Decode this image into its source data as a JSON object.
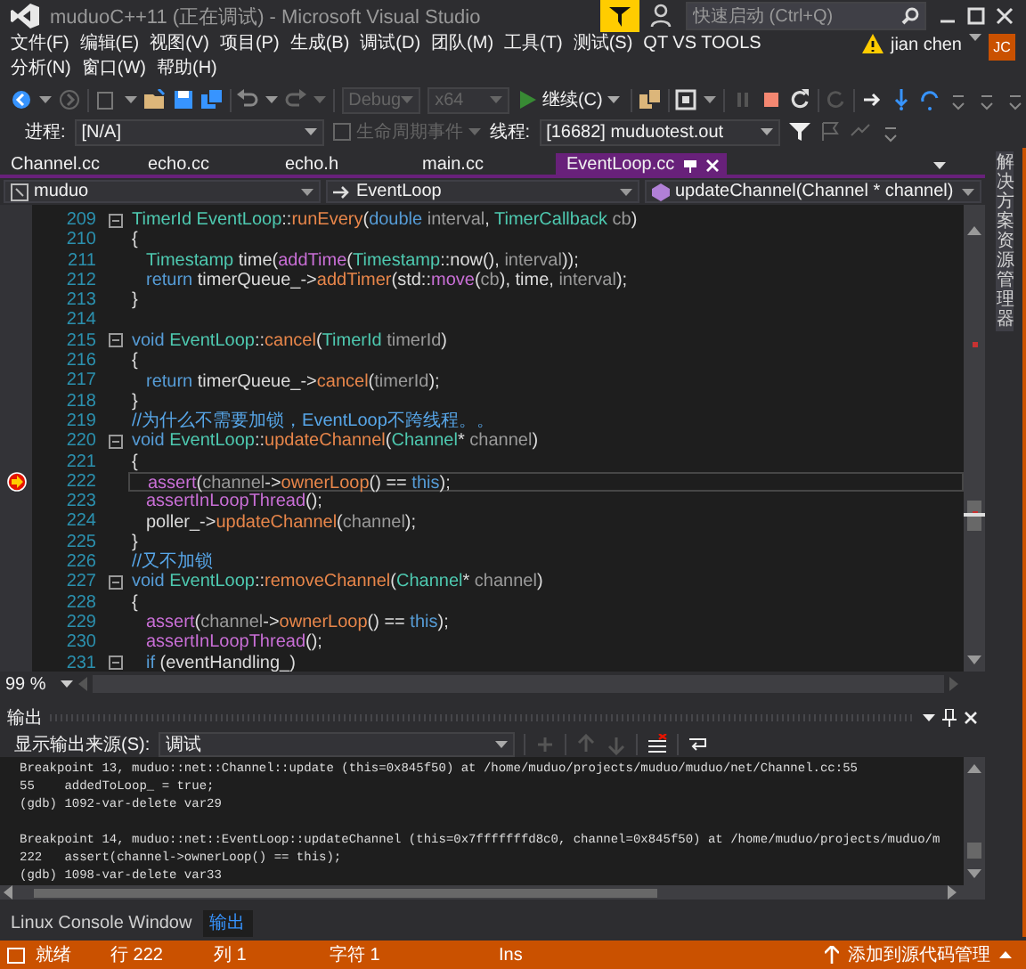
{
  "window": {
    "title": "muduoC++11 (正在调试) - Microsoft Visual Studio"
  },
  "quick_launch": {
    "placeholder": "快速启动 (Ctrl+Q)"
  },
  "account": {
    "name": "jian chen",
    "initials": "JC"
  },
  "menu": [
    "文件(F)",
    "编辑(E)",
    "视图(V)",
    "项目(P)",
    "生成(B)",
    "调试(D)",
    "团队(M)",
    "工具(T)",
    "测试(S)",
    "QT VS TOOLS",
    "分析(N)",
    "窗口(W)",
    "帮助(H)"
  ],
  "toolbar": {
    "configuration": "Debug",
    "platform": "x64",
    "continue": "继续(C)"
  },
  "debug_location": {
    "process_label": "进程:",
    "process": "[N/A]",
    "lifecycle": "生命周期事件",
    "thread_label": "线程:",
    "thread": "[16682] muduotest.out"
  },
  "tabs": [
    {
      "label": "Channel.cc",
      "selected": false
    },
    {
      "label": "echo.cc",
      "selected": false
    },
    {
      "label": "echo.h",
      "selected": false
    },
    {
      "label": "main.cc",
      "selected": false
    },
    {
      "label": "EventLoop.cc",
      "selected": true
    }
  ],
  "navigation": {
    "project": "muduo",
    "scope": "EventLoop",
    "member": "updateChannel(Channel * channel)"
  },
  "editor": {
    "lines": [
      {
        "number": "209",
        "fold": true,
        "body": false,
        "breakpoint": false,
        "tokens": [
          {
            "kind": "type",
            "text": "TimerId"
          },
          {
            "kind": "type",
            "text": " EventLoop"
          },
          {
            "kind": "plain",
            "text": "::"
          },
          {
            "kind": "function",
            "text": "runEvery"
          },
          {
            "kind": "plain",
            "text": "("
          },
          {
            "kind": "keyword",
            "text": "double"
          },
          {
            "kind": "param",
            "text": " interval"
          },
          {
            "kind": "plain",
            "text": ", "
          },
          {
            "kind": "type",
            "text": "TimerCallback"
          },
          {
            "kind": "param",
            "text": " cb"
          },
          {
            "kind": "plain",
            "text": ")"
          }
        ]
      },
      {
        "number": "210",
        "fold": false,
        "body": false,
        "breakpoint": false,
        "tokens": [
          {
            "kind": "plain",
            "text": "{"
          }
        ]
      },
      {
        "number": "211",
        "fold": false,
        "body": true,
        "breakpoint": false,
        "tokens": [
          {
            "kind": "type",
            "text": "Timestamp"
          },
          {
            "kind": "plain",
            "text": " time("
          },
          {
            "kind": "macro",
            "text": "addTime"
          },
          {
            "kind": "plain",
            "text": "("
          },
          {
            "kind": "type",
            "text": "Timestamp"
          },
          {
            "kind": "plain",
            "text": "::now(), "
          },
          {
            "kind": "param",
            "text": "interval"
          },
          {
            "kind": "plain",
            "text": "));"
          }
        ]
      },
      {
        "number": "212",
        "fold": false,
        "body": true,
        "breakpoint": false,
        "tokens": [
          {
            "kind": "keyword",
            "text": "return"
          },
          {
            "kind": "plain",
            "text": " timerQueue_->"
          },
          {
            "kind": "function",
            "text": "addTimer"
          },
          {
            "kind": "plain",
            "text": "(std::"
          },
          {
            "kind": "macro",
            "text": "move"
          },
          {
            "kind": "plain",
            "text": "("
          },
          {
            "kind": "param",
            "text": "cb"
          },
          {
            "kind": "plain",
            "text": "), time, "
          },
          {
            "kind": "param",
            "text": "interval"
          },
          {
            "kind": "plain",
            "text": ");"
          }
        ]
      },
      {
        "number": "213",
        "fold": false,
        "body": false,
        "breakpoint": false,
        "tokens": [
          {
            "kind": "plain",
            "text": "}"
          }
        ]
      },
      {
        "number": "214",
        "fold": false
      },
      {
        "number": "215",
        "fold": true,
        "body": false,
        "breakpoint": false,
        "tokens": [
          {
            "kind": "keyword",
            "text": "void"
          },
          {
            "kind": "type",
            "text": " EventLoop"
          },
          {
            "kind": "plain",
            "text": "::"
          },
          {
            "kind": "function",
            "text": "cancel"
          },
          {
            "kind": "plain",
            "text": "("
          },
          {
            "kind": "type",
            "text": "TimerId"
          },
          {
            "kind": "param",
            "text": " timerId"
          },
          {
            "kind": "plain",
            "text": ")"
          }
        ]
      },
      {
        "number": "216",
        "fold": false,
        "body": false,
        "breakpoint": false,
        "tokens": [
          {
            "kind": "plain",
            "text": "{"
          }
        ]
      },
      {
        "number": "217",
        "fold": false,
        "body": true,
        "breakpoint": false,
        "tokens": [
          {
            "kind": "keyword",
            "text": "return"
          },
          {
            "kind": "plain",
            "text": " timerQueue_->"
          },
          {
            "kind": "function",
            "text": "cancel"
          },
          {
            "kind": "plain",
            "text": "("
          },
          {
            "kind": "param",
            "text": "timerId"
          },
          {
            "kind": "plain",
            "text": ");"
          }
        ]
      },
      {
        "number": "218",
        "fold": false,
        "body": false,
        "breakpoint": false,
        "tokens": [
          {
            "kind": "plain",
            "text": "}"
          }
        ]
      },
      {
        "number": "219",
        "fold": false,
        "body": false,
        "breakpoint": false,
        "tokens": [
          {
            "kind": "comment",
            "text": "//为什么不需要加锁，EventLoop不跨线程。。"
          }
        ]
      },
      {
        "number": "220",
        "fold": true,
        "body": false,
        "breakpoint": false,
        "tokens": [
          {
            "kind": "keyword",
            "text": "void"
          },
          {
            "kind": "type",
            "text": " EventLoop"
          },
          {
            "kind": "plain",
            "text": "::"
          },
          {
            "kind": "function",
            "text": "updateChannel"
          },
          {
            "kind": "plain",
            "text": "("
          },
          {
            "kind": "type",
            "text": "Channel"
          },
          {
            "kind": "plain",
            "text": "* "
          },
          {
            "kind": "param",
            "text": "channel"
          },
          {
            "kind": "plain",
            "text": ")"
          }
        ]
      },
      {
        "number": "221",
        "fold": false,
        "body": false,
        "breakpoint": false,
        "tokens": [
          {
            "kind": "plain",
            "text": "{"
          }
        ]
      },
      {
        "number": "222",
        "fold": false,
        "body": true,
        "breakpoint": true,
        "tokens": [
          {
            "kind": "macro",
            "text": "assert"
          },
          {
            "kind": "plain",
            "text": "("
          },
          {
            "kind": "param",
            "text": "channel"
          },
          {
            "kind": "plain",
            "text": "->"
          },
          {
            "kind": "function",
            "text": "ownerLoop"
          },
          {
            "kind": "plain",
            "text": "() == "
          },
          {
            "kind": "keyword",
            "text": "this"
          },
          {
            "kind": "plain",
            "text": ");"
          }
        ]
      },
      {
        "number": "223",
        "fold": false,
        "body": true,
        "breakpoint": false,
        "tokens": [
          {
            "kind": "macro",
            "text": "assertInLoopThread"
          },
          {
            "kind": "plain",
            "text": "();"
          }
        ]
      },
      {
        "number": "224",
        "fold": false,
        "body": true,
        "breakpoint": false,
        "tokens": [
          {
            "kind": "plain",
            "text": "poller_->"
          },
          {
            "kind": "function",
            "text": "updateChannel"
          },
          {
            "kind": "plain",
            "text": "("
          },
          {
            "kind": "param",
            "text": "channel"
          },
          {
            "kind": "plain",
            "text": ");"
          }
        ]
      },
      {
        "number": "225",
        "fold": false,
        "body": false,
        "breakpoint": false,
        "tokens": [
          {
            "kind": "plain",
            "text": "}"
          }
        ]
      },
      {
        "number": "226",
        "fold": false,
        "body": false,
        "breakpoint": false,
        "tokens": [
          {
            "kind": "comment",
            "text": "//又不加锁"
          }
        ]
      },
      {
        "number": "227",
        "fold": true,
        "body": false,
        "breakpoint": false,
        "tokens": [
          {
            "kind": "keyword",
            "text": "void"
          },
          {
            "kind": "type",
            "text": " EventLoop"
          },
          {
            "kind": "plain",
            "text": "::"
          },
          {
            "kind": "function",
            "text": "removeChannel"
          },
          {
            "kind": "plain",
            "text": "("
          },
          {
            "kind": "type",
            "text": "Channel"
          },
          {
            "kind": "plain",
            "text": "* "
          },
          {
            "kind": "param",
            "text": "channel"
          },
          {
            "kind": "plain",
            "text": ")"
          }
        ]
      },
      {
        "number": "228",
        "fold": false,
        "body": false,
        "breakpoint": false,
        "tokens": [
          {
            "kind": "plain",
            "text": "{"
          }
        ]
      },
      {
        "number": "229",
        "fold": false,
        "body": true,
        "breakpoint": false,
        "tokens": [
          {
            "kind": "macro",
            "text": "assert"
          },
          {
            "kind": "plain",
            "text": "("
          },
          {
            "kind": "param",
            "text": "channel"
          },
          {
            "kind": "plain",
            "text": "->"
          },
          {
            "kind": "function",
            "text": "ownerLoop"
          },
          {
            "kind": "plain",
            "text": "() == "
          },
          {
            "kind": "keyword",
            "text": "this"
          },
          {
            "kind": "plain",
            "text": ");"
          }
        ]
      },
      {
        "number": "230",
        "fold": false,
        "body": true,
        "breakpoint": false,
        "tokens": [
          {
            "kind": "macro",
            "text": "assertInLoopThread"
          },
          {
            "kind": "plain",
            "text": "();"
          }
        ]
      },
      {
        "number": "231",
        "fold": true,
        "body": true,
        "breakpoint": false,
        "tokens": [
          {
            "kind": "keyword",
            "text": "if"
          },
          {
            "kind": "plain",
            "text": " (eventHandling_)"
          }
        ]
      }
    ]
  },
  "zoom": "99 %",
  "side_panel": "解决方案资源管理器",
  "output": {
    "title": "输出",
    "source_label": "显示输出来源(S):",
    "source": "调试",
    "lines": [
      "Breakpoint 13, muduo::net::Channel::update (this=0x845f50) at /home/muduo/projects/muduo/muduo/net/Channel.cc:55",
      "55    addedToLoop_ = true;",
      "(gdb) 1092-var-delete var29",
      "Breakpoint 14, muduo::net::EventLoop::updateChannel (this=0x7fffffffd8c0, channel=0x845f50) at /home/muduo/projects/muduo/m",
      "222   assert(channel->ownerLoop() == this);",
      "(gdb) 1098-var-delete var33"
    ]
  },
  "bottom_tabs": [
    {
      "label": "Linux Console Window",
      "selected": false
    },
    {
      "label": "输出",
      "selected": true
    }
  ],
  "status_bar": {
    "state": "就绪",
    "line": "行 222",
    "column": "列 1",
    "char": "字符 1",
    "mode": "Ins",
    "source_control": "添加到源代码管理"
  }
}
